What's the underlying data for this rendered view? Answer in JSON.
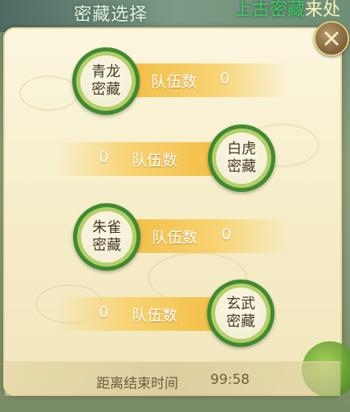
{
  "background": {
    "title": "密藏选择",
    "right_text_highlight": "上古密藏",
    "right_text": "来处"
  },
  "close_icon": "close-icon",
  "treasures": [
    {
      "name_line1": "青龙",
      "name_line2": "密藏",
      "label": "队伍数",
      "count": "0",
      "side": "left"
    },
    {
      "name_line1": "白虎",
      "name_line2": "密藏",
      "label": "队伍数",
      "count": "0",
      "side": "right"
    },
    {
      "name_line1": "朱雀",
      "name_line2": "密藏",
      "label": "队伍数",
      "count": "0",
      "side": "left"
    },
    {
      "name_line1": "玄武",
      "name_line2": "密藏",
      "label": "队伍数",
      "count": "0",
      "side": "right"
    }
  ],
  "footer": {
    "label": "距离结束时间",
    "time": "99:58"
  },
  "colors": {
    "panel": "#f6eec9",
    "bar": "#f3be46",
    "medal_green": "#3f8a2f",
    "close_button": "#7d6038"
  }
}
